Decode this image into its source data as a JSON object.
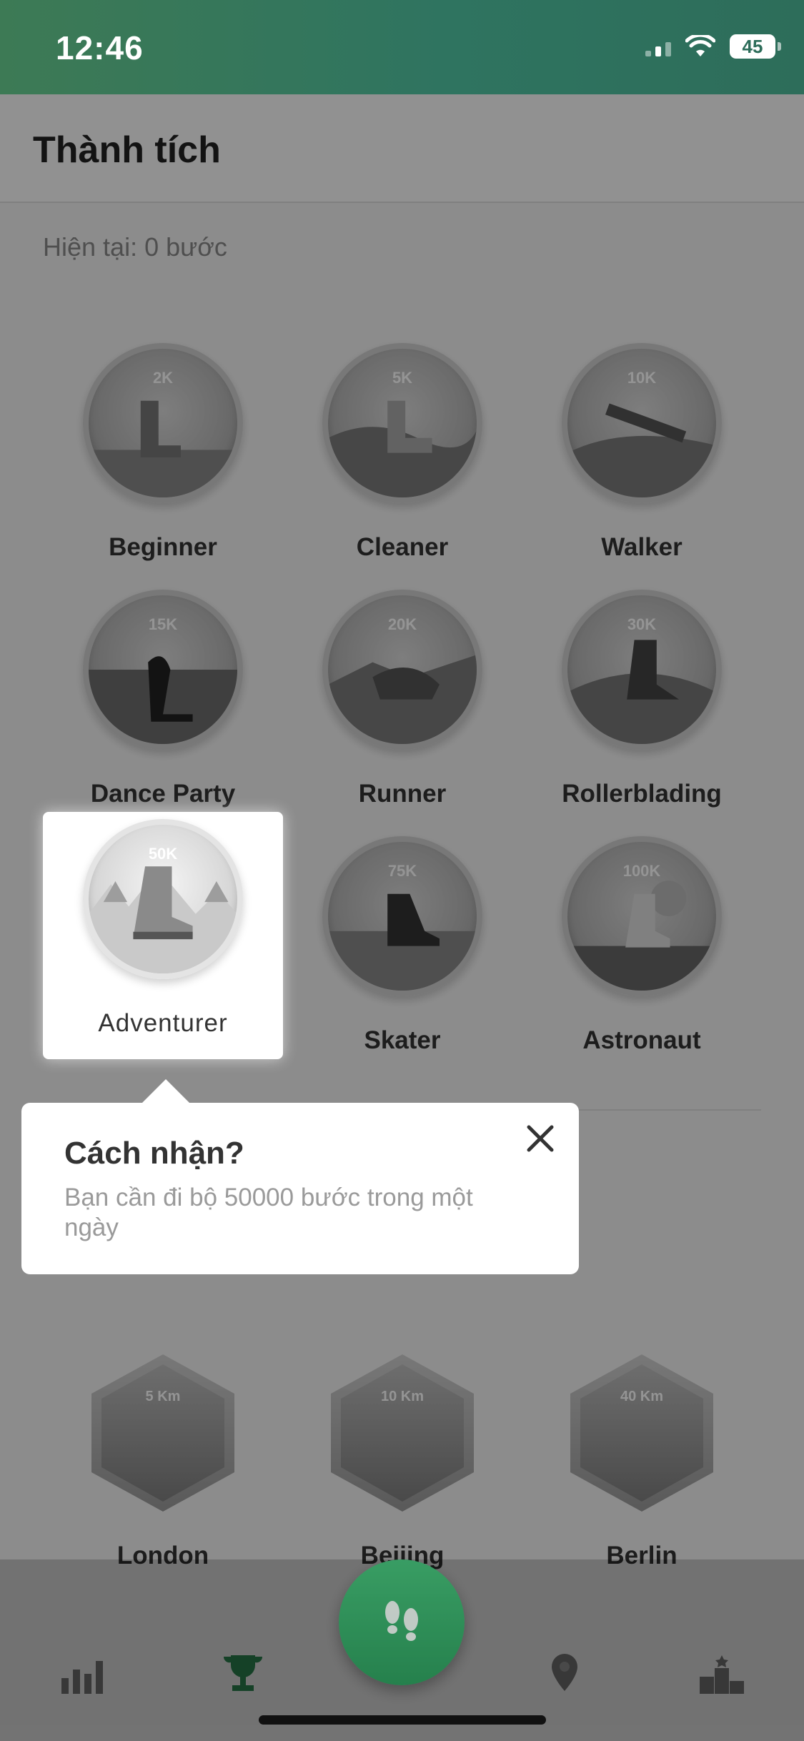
{
  "status_bar": {
    "time": "12:46",
    "battery": "45"
  },
  "header": {
    "title": "Thành tích"
  },
  "steps": {
    "current": "Hiện tại: 0 bước"
  },
  "badges": [
    {
      "milestone": "2K",
      "name": "Beginner"
    },
    {
      "milestone": "5K",
      "name": "Cleaner"
    },
    {
      "milestone": "10K",
      "name": "Walker"
    },
    {
      "milestone": "15K",
      "name": "Dance Party"
    },
    {
      "milestone": "20K",
      "name": "Runner"
    },
    {
      "milestone": "30K",
      "name": "Rollerblading"
    },
    {
      "milestone": "50K",
      "name": "Adventurer"
    },
    {
      "milestone": "75K",
      "name": "Skater"
    },
    {
      "milestone": "100K",
      "name": "Astronaut"
    }
  ],
  "distance_badges": [
    {
      "milestone": "5 Km",
      "name": "London"
    },
    {
      "milestone": "10 Km",
      "name": "Beijing"
    },
    {
      "milestone": "40 Km",
      "name": "Berlin"
    }
  ],
  "popup": {
    "title": "Cách nhận?",
    "text": "Bạn cần đi bộ 50000 bước trong một ngày"
  },
  "nav": {
    "items": [
      "stats-icon",
      "trophy-icon",
      "footsteps-icon",
      "location-icon",
      "leaderboard-icon"
    ],
    "active_color": "#3fae6c"
  }
}
